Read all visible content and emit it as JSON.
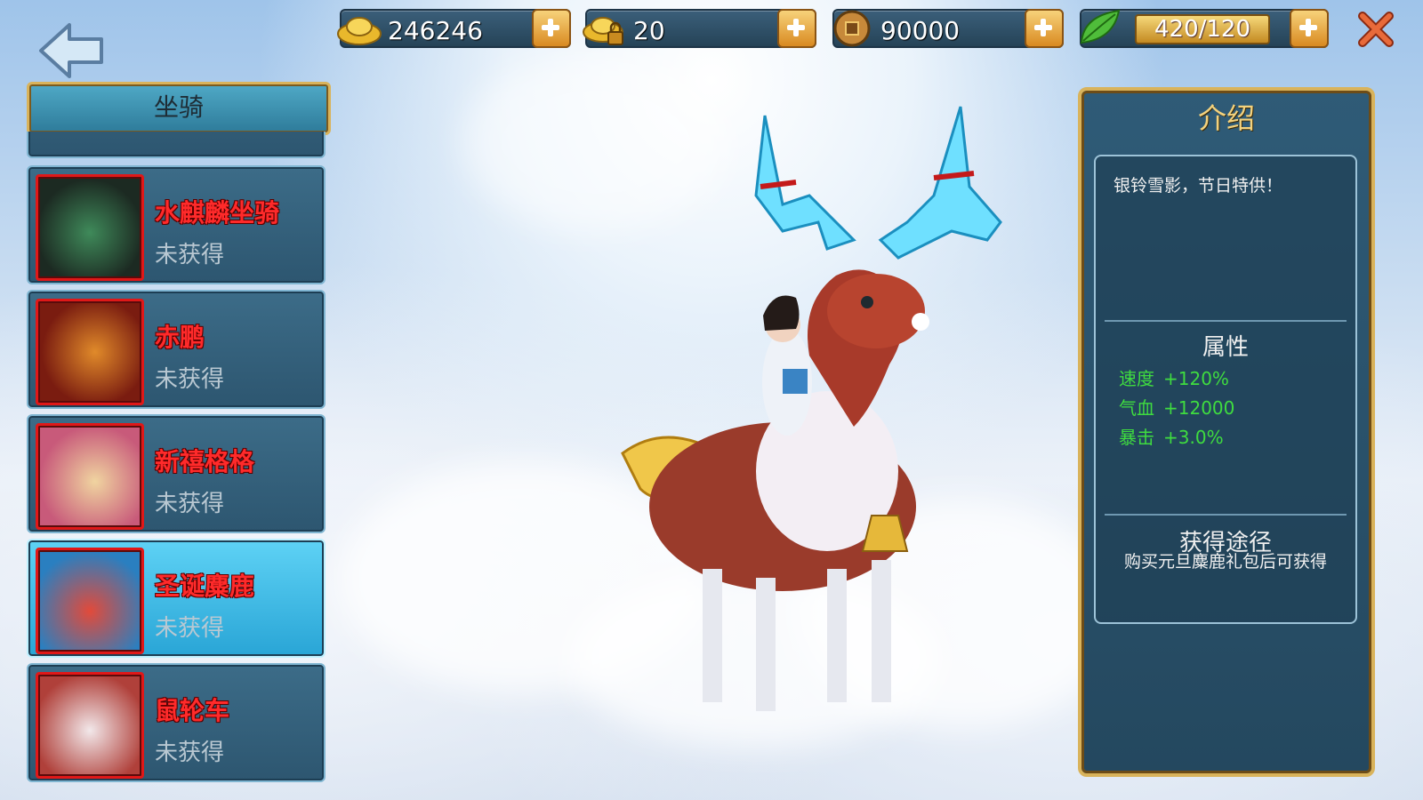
{
  "topbar": {
    "gold": "246246",
    "bound_gold": "20",
    "coins": "90000",
    "stamina": "420/120"
  },
  "left_panel": {
    "title": "坐骑",
    "items": [
      {
        "name": "水麒麟坐骑",
        "status": "未获得"
      },
      {
        "name": "赤鹏",
        "status": "未获得"
      },
      {
        "name": "新禧格格",
        "status": "未获得"
      },
      {
        "name": "圣诞麋鹿",
        "status": "未获得",
        "selected": true
      },
      {
        "name": "鼠轮车",
        "status": "未获得"
      }
    ]
  },
  "intro": {
    "title": "介绍",
    "description": "银铃雪影，节日特供！",
    "attributes_heading": "属性",
    "stats": [
      {
        "label": "速度",
        "value": "+120%"
      },
      {
        "label": "气血",
        "value": "+12000"
      },
      {
        "label": "暴击",
        "value": "+3.0%"
      }
    ],
    "source_heading": "获得途径",
    "source_text": "购买元旦麋鹿礼包后可获得"
  },
  "icons": [
    "back-arrow-icon",
    "gold-ingot-icon",
    "locked-ingot-icon",
    "coin-icon",
    "leaf-icon",
    "plus-icon",
    "close-icon"
  ],
  "colors": {
    "accent_gold": "#d9b35b",
    "name_red": "#ff2a2a",
    "stat_green": "#3fdc3f"
  }
}
